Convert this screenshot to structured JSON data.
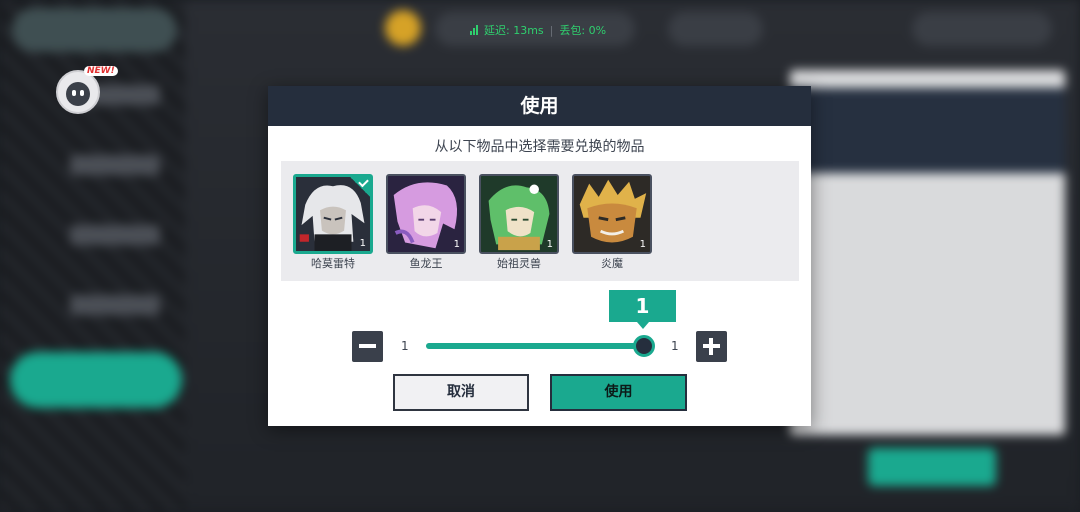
{
  "network": {
    "latency_label": "延迟: 13ms",
    "packet_loss_label": "丢包: 0%",
    "status_color": "#2fcf6e"
  },
  "badge": {
    "new_label": "NEW!"
  },
  "dialog": {
    "title": "使用",
    "subtitle": "从以下物品中选择需要兑换的物品",
    "items": [
      {
        "name": "哈莫雷特",
        "count": "1",
        "selected": true
      },
      {
        "name": "鱼龙王",
        "count": "1",
        "selected": false
      },
      {
        "name": "始祖灵兽",
        "count": "1",
        "selected": false
      },
      {
        "name": "炎魔",
        "count": "1",
        "selected": false
      }
    ],
    "quantity": {
      "current": "1",
      "min": "1",
      "max": "1",
      "fill_fraction": 1.0
    },
    "cancel_label": "取消",
    "confirm_label": "使用"
  },
  "colors": {
    "accent": "#1aa98f",
    "header": "#252e3d"
  }
}
